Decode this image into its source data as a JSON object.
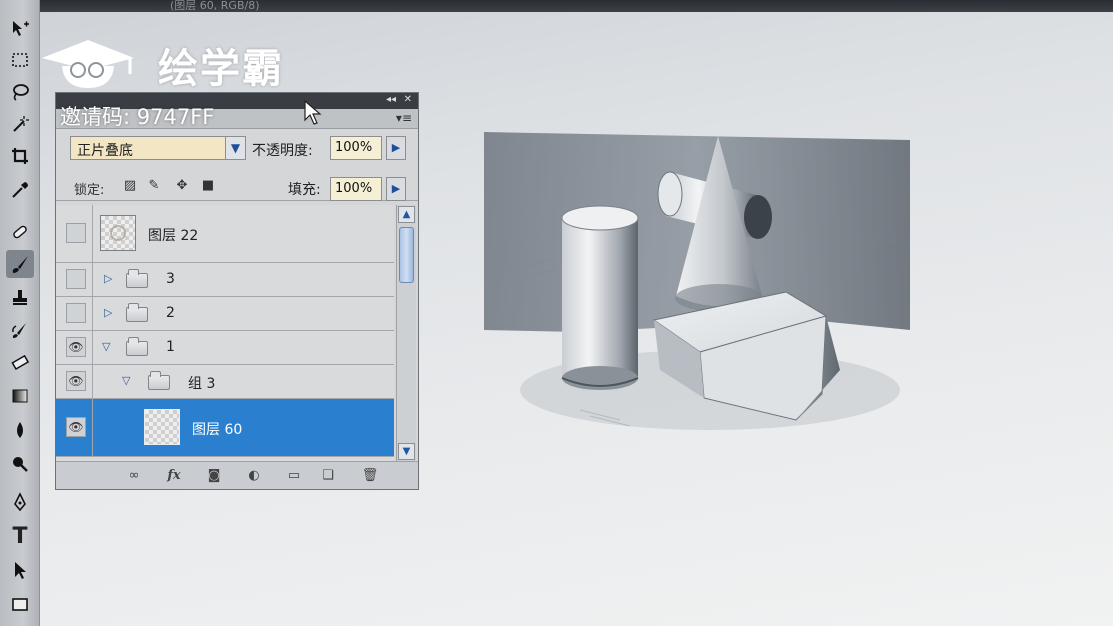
{
  "window": {
    "title_fragment": "(图层 60, RGB/8)"
  },
  "watermark": {
    "brand": "绘学霸",
    "invite_code": "邀请码: 9747FF"
  },
  "toolbox": {
    "tools": [
      "move-tool-icon",
      "marquee-tool-icon",
      "lasso-tool-icon",
      "magic-wand-icon",
      "crop-tool-icon",
      "eyedropper-icon",
      "healing-brush-icon",
      "brush-tool-icon",
      "clone-stamp-icon",
      "history-brush-icon",
      "eraser-icon",
      "gradient-tool-icon",
      "blur-tool-icon",
      "dodge-tool-icon",
      "pen-tool-icon",
      "type-tool-icon",
      "path-selection-icon",
      "shape-tool-icon"
    ],
    "active": "brush-tool-icon",
    "type_glyph": "T"
  },
  "layers_panel": {
    "blend_mode": "正片叠底",
    "opacity_label": "不透明度:",
    "opacity_value": "100%",
    "lock_label": "锁定:",
    "fill_label": "填充:",
    "fill_value": "100%",
    "layers": [
      {
        "name": "图层 22",
        "kind": "layer",
        "visible": false,
        "selected": false
      },
      {
        "name": "3",
        "kind": "group",
        "expanded": false,
        "visible": false,
        "selected": false
      },
      {
        "name": "2",
        "kind": "group",
        "expanded": false,
        "visible": false,
        "selected": false
      },
      {
        "name": "1",
        "kind": "group",
        "expanded": true,
        "visible": true,
        "selected": false
      },
      {
        "name": "组 3",
        "kind": "group",
        "expanded": true,
        "visible": true,
        "selected": false
      },
      {
        "name": "图层 60",
        "kind": "layer",
        "visible": true,
        "selected": true
      }
    ],
    "footer_icons": [
      "link-layers-icon",
      "layer-style-fx-icon",
      "layer-mask-icon",
      "adjustment-layer-icon",
      "new-group-icon",
      "new-layer-icon",
      "delete-layer-icon"
    ],
    "fx_label": "fx"
  },
  "colors": {
    "selection": "#2b7fcf",
    "panel_bg": "#d4d6d8",
    "field_bg": "#f5efd6"
  }
}
